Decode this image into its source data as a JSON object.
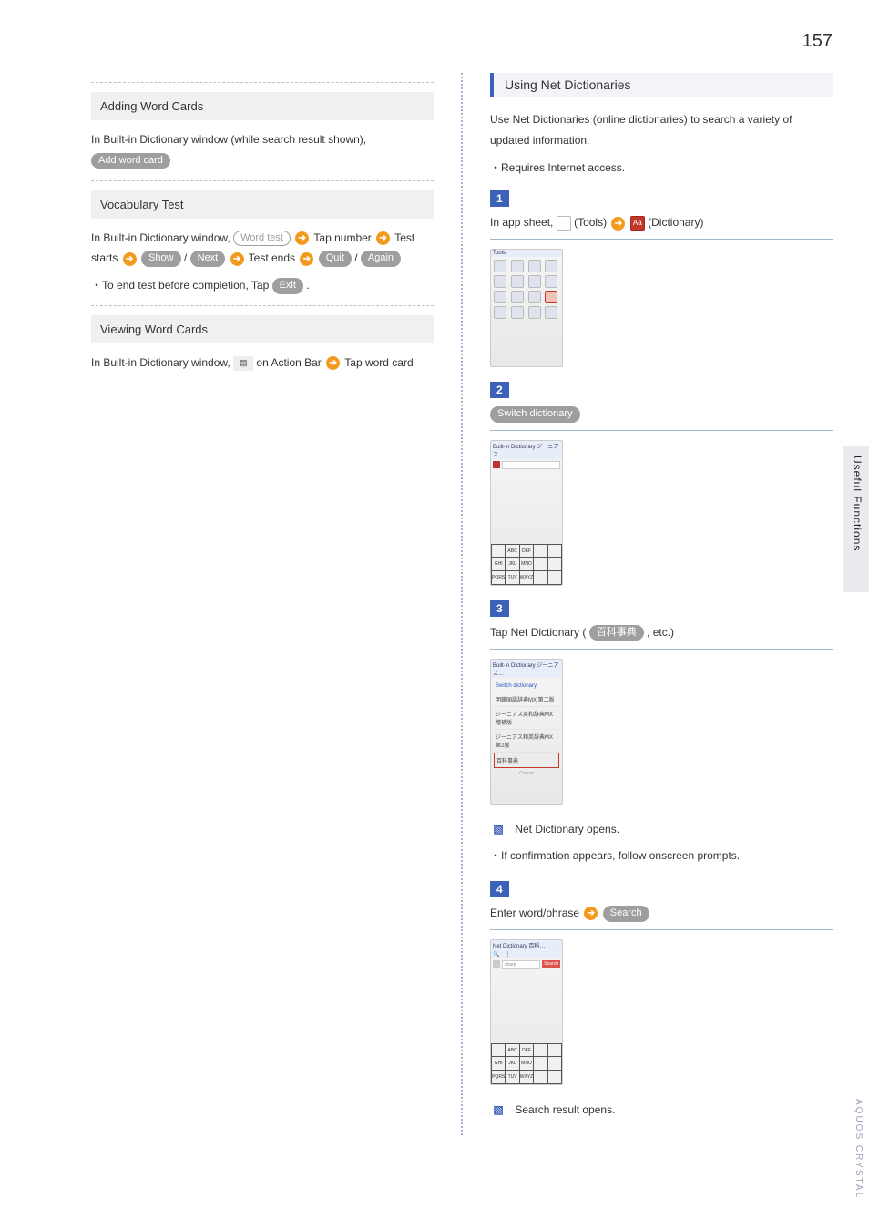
{
  "page_number": "157",
  "side": {
    "label1": "Useful Functions",
    "label2": "AQUOS CRYSTAL"
  },
  "left": {
    "adding": {
      "heading": "Adding Word Cards",
      "line": "In Built-in Dictionary window (while search result shown),",
      "btn_add": "Add word card"
    },
    "vocab": {
      "heading": "Vocabulary Test",
      "t1": "In Built-in Dictionary window, ",
      "btn_wordtest": "Word test",
      "t2": " Tap number ",
      "t3": " Test starts ",
      "btn_show": "Show",
      "t_slash": " / ",
      "btn_next": "Next",
      "t4": " Test ends ",
      "btn_quit": "Quit",
      "btn_again": "Again",
      "note1": "To end test before completion, Tap ",
      "btn_exit": "Exit",
      "note1_end": " ."
    },
    "viewing": {
      "heading": "Viewing Word Cards",
      "t1": "In Built-in Dictionary window, ",
      "t2": " on Action Bar ",
      "t3": " Tap word card"
    }
  },
  "right": {
    "title": "Using Net Dictionaries",
    "intro": "Use Net Dictionaries (online dictionaries) to search a variety of updated information.",
    "note_req": "Requires Internet access.",
    "step1": {
      "num": "1",
      "t1": "In app sheet, ",
      "t_tools": " (Tools) ",
      "t_dict": " (Dictionary)"
    },
    "step2": {
      "num": "2",
      "btn_switch": "Switch dictionary"
    },
    "step3": {
      "num": "3",
      "t1": "Tap Net Dictionary ( ",
      "btn_enc": "百科事典",
      "t2": " , etc.)",
      "result1": "Net Dictionary opens.",
      "note1": "If confirmation appears, follow onscreen prompts."
    },
    "step4": {
      "num": "4",
      "t1": "Enter word/phrase ",
      "btn_search": "Search",
      "result1": "Search result opens."
    }
  }
}
